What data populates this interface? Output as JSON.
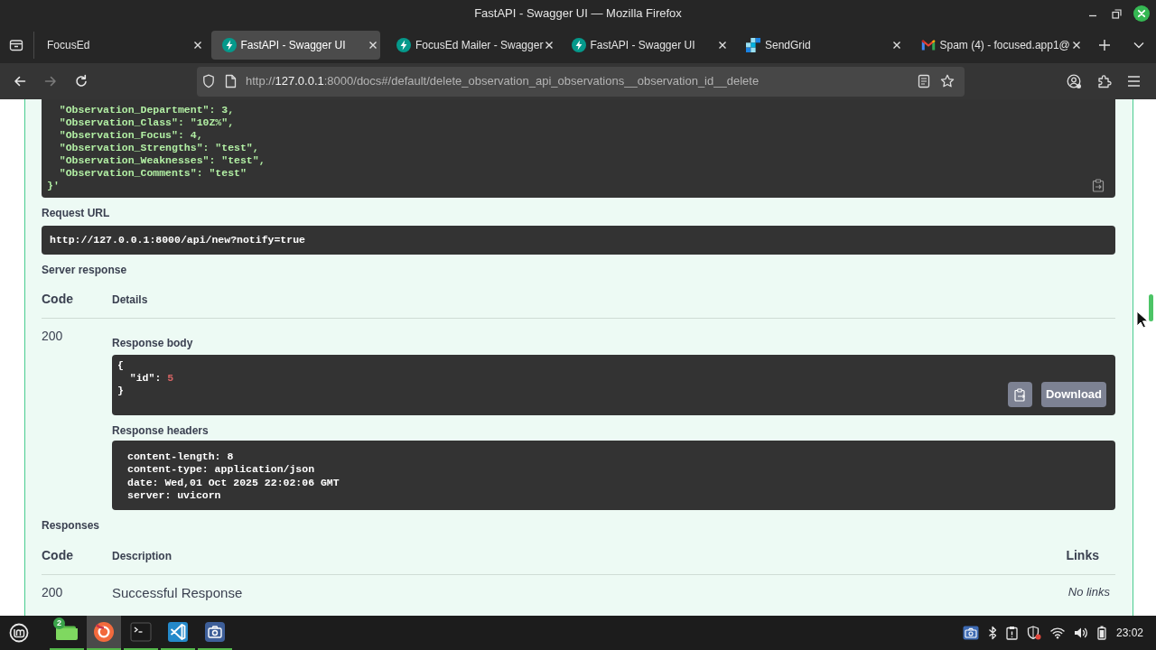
{
  "window": {
    "title": "FastAPI - Swagger UI — Mozilla Firefox"
  },
  "tabs": [
    {
      "title": "FocusEd",
      "kind": "plain",
      "selected": false
    },
    {
      "title": "FastAPI - Swagger UI",
      "kind": "fastapi",
      "selected": true
    },
    {
      "title": "FocusEd Mailer - Swagger",
      "kind": "fastapi",
      "selected": false
    },
    {
      "title": "FastAPI - Swagger UI",
      "kind": "fastapi",
      "selected": false
    },
    {
      "title": "SendGrid",
      "kind": "sendgrid",
      "selected": false
    },
    {
      "title": "Spam (4) - focused.app1@",
      "kind": "mail",
      "selected": false
    }
  ],
  "navigation": [
    {
      "kind": "back",
      "disabled": false
    },
    {
      "kind": "forward",
      "disabled": true
    },
    {
      "kind": "reload",
      "disabled": false
    }
  ],
  "address_bar": {
    "scheme": "http://",
    "host": "127.0.0.1",
    "path": ":8000/docs#/default/delete_observation_api_observations__observation_id__delete"
  },
  "request_body": {
    "lines": [
      "  \"Observation_Department\": 3,",
      "  \"Observation_Class\": \"10Z%\",",
      "  \"Observation_Focus\": 4,",
      "  \"Observation_Strengths\": \"test\",",
      "  \"Observation_Weaknesses\": \"test\",",
      "  \"Observation_Comments\": \"test\"",
      "}'"
    ]
  },
  "request_url": {
    "label": "Request URL",
    "value": "http://127.0.0.1:8000/api/new?notify=true"
  },
  "server_response": {
    "label": "Server response",
    "columns": [
      "Code",
      "Details"
    ],
    "code": "200",
    "body_label": "Response body",
    "body_lines": [
      [
        {
          "kind": "punct",
          "text": "{"
        }
      ],
      [
        {
          "kind": "key",
          "text": "  \"id\": "
        },
        {
          "kind": "number",
          "text": "5"
        }
      ],
      [
        {
          "kind": "punct",
          "text": "}"
        }
      ]
    ],
    "download_button": "Download",
    "headers_label": "Response headers",
    "headers": [
      "content-length: 8",
      "content-type: application/json",
      "date: Wed,01 Oct 2025 22:02:06 GMT",
      "server: uvicorn"
    ]
  },
  "responses": {
    "label": "Responses",
    "columns": [
      "Code",
      "Description",
      "Links"
    ],
    "rows": [
      {
        "code": "200",
        "description": "Successful Response",
        "links": "No links"
      }
    ]
  },
  "taskbar": {
    "apps": [
      {
        "kind": "files",
        "badge": "2",
        "active": false
      },
      {
        "kind": "browser",
        "active": true
      },
      {
        "kind": "terminal",
        "active": false
      },
      {
        "kind": "editor",
        "active": false
      },
      {
        "kind": "camera",
        "active": false
      }
    ],
    "clock": "23:02"
  }
}
